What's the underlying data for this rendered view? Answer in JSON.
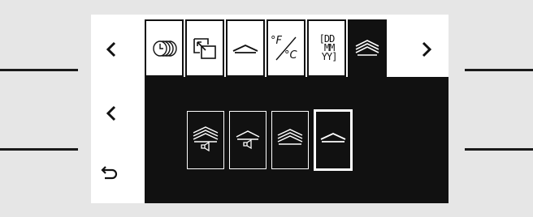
{
  "device": {
    "nav": {
      "prev_tab_icon": "chevron-left-icon",
      "next_tab_icon": "chevron-right-icon",
      "prev_option_icon": "chevron-left-icon",
      "back_icon": "back-arrow-icon"
    },
    "tabs": [
      {
        "name": "timer-rings-tab",
        "icon": "rings-icon"
      },
      {
        "name": "window-tab",
        "icon": "window-arrow-icon"
      },
      {
        "name": "roof-tab",
        "icon": "roof-icon"
      },
      {
        "name": "temperature-unit-tab",
        "icon": "temperature-unit-icon",
        "text_f": "°F",
        "text_c": "°C"
      },
      {
        "name": "date-format-tab",
        "icon": "date-format-icon",
        "text": "[DD\n MM\n YY]"
      },
      {
        "name": "roof-sound-tab",
        "icon": "roof-sound-icon",
        "active": true
      }
    ],
    "options": [
      {
        "name": "option-roof-sound",
        "icon": "roof-sound-icon"
      },
      {
        "name": "option-small-roof-sound",
        "icon": "small-roof-sound-icon"
      },
      {
        "name": "option-roof-lines",
        "icon": "roof-lines-icon"
      },
      {
        "name": "option-roof",
        "icon": "roof-icon",
        "selected": true
      }
    ],
    "colors": {
      "bezel": "#e6e6e6",
      "screen_bg": "#ffffff",
      "panel_bg": "#111111",
      "ink": "#111111"
    }
  }
}
